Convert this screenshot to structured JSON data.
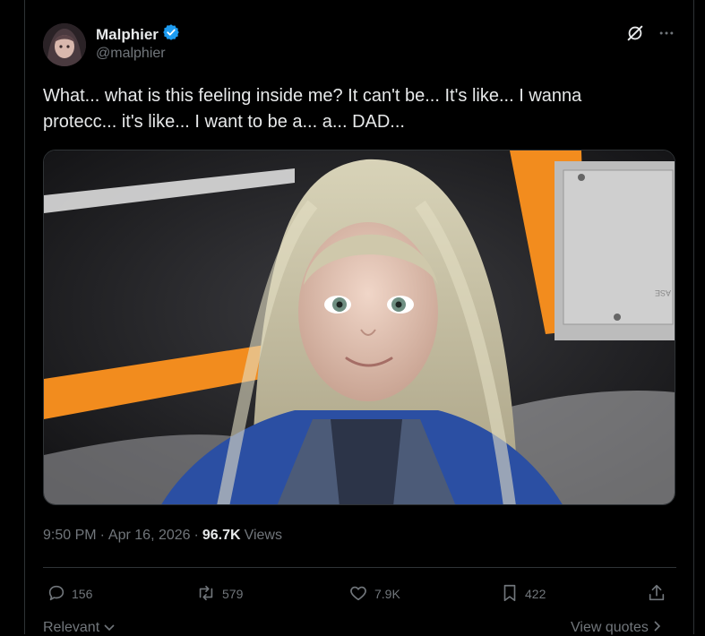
{
  "user": {
    "name": "Malphier",
    "handle": "@malphier",
    "verified": true
  },
  "tweet": {
    "text": "What... what is this feeling inside me? It can't be... It's like... I wanna protecc... it's like... I want to be a... a... DAD...",
    "image_label": "ASE"
  },
  "meta": {
    "time": "9:50 PM",
    "sep1": "·",
    "date": "Apr 16, 2026",
    "sep2": "·",
    "views_count": "96.7K",
    "views_label": "Views"
  },
  "actions": {
    "replies": "156",
    "reposts": "579",
    "likes": "7.9K",
    "bookmarks": "422"
  },
  "footer": {
    "sort_label": "Relevant",
    "quotes_label": "View quotes"
  },
  "colors": {
    "background": "#000000",
    "text": "#e7e9ea",
    "muted": "#71767b",
    "verified": "#1d9bf0",
    "orange": "#f28c1e"
  }
}
